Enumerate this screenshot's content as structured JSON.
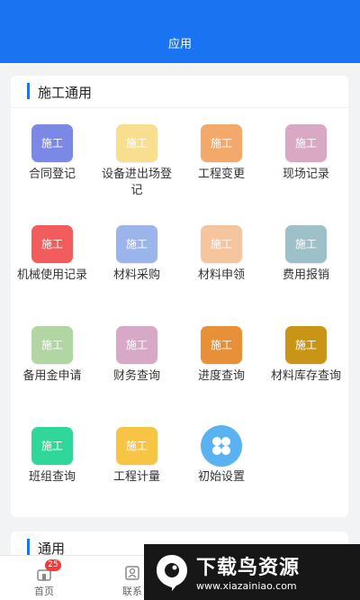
{
  "header": {
    "title": "应用"
  },
  "section1": {
    "title": "施工通用",
    "items": [
      {
        "label": "合同登记",
        "tile_text": "施工",
        "color": "#7b88e6"
      },
      {
        "label": "设备进出场登记",
        "tile_text": "施工",
        "color": "#f7df8f"
      },
      {
        "label": "工程变更",
        "tile_text": "施工",
        "color": "#f2a96a"
      },
      {
        "label": "现场记录",
        "tile_text": "施工",
        "color": "#d9a9c4"
      },
      {
        "label": "机械使用记录",
        "tile_text": "施工",
        "color": "#f25c5c"
      },
      {
        "label": "材料采购",
        "tile_text": "施工",
        "color": "#9cb4ec"
      },
      {
        "label": "材料申领",
        "tile_text": "施工",
        "color": "#f5c59e"
      },
      {
        "label": "费用报销",
        "tile_text": "施工",
        "color": "#9ec0c9"
      },
      {
        "label": "备用金申请",
        "tile_text": "施工",
        "color": "#b2d5a4"
      },
      {
        "label": "财务查询",
        "tile_text": "施工",
        "color": "#d8a9c6"
      },
      {
        "label": "进度查询",
        "tile_text": "施工",
        "color": "#e89038"
      },
      {
        "label": "材料库存查询",
        "tile_text": "施工",
        "color": "#c99516"
      },
      {
        "label": "班组查询",
        "tile_text": "施工",
        "color": "#2fd89a"
      },
      {
        "label": "工程计量",
        "tile_text": "施工",
        "color": "#f7c444"
      },
      {
        "label": "初始设置",
        "tile_text": "",
        "color": "#5ab3f0",
        "icon": "grid-icon"
      }
    ]
  },
  "section2": {
    "title": "通用"
  },
  "tabbar": {
    "tabs": [
      {
        "label": "首页",
        "badge": "25",
        "icon": "home-icon"
      },
      {
        "label": "联系",
        "icon": "contacts-icon"
      }
    ]
  },
  "watermark": {
    "title": "下载鸟资源",
    "url": "www.xiazainiao.com"
  }
}
